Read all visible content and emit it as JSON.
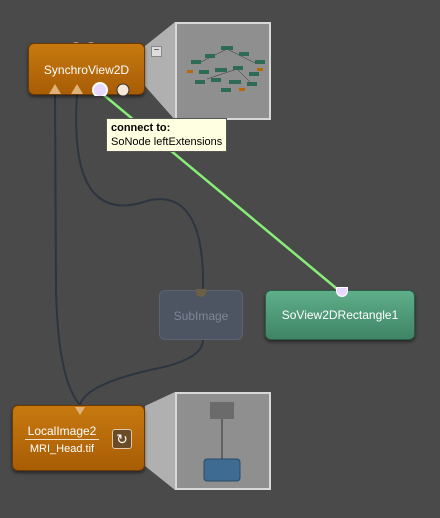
{
  "nodes": {
    "synchro": {
      "name": "SynchroView2D"
    },
    "rect": {
      "name": "SoView2DRectangle1"
    },
    "subimage": {
      "name": "SubImage"
    },
    "local": {
      "name": "LocalImage2",
      "file": "MRI_Head.tif"
    }
  },
  "tooltip": {
    "title": "connect to:",
    "detail": "SoNode leftExtensions"
  },
  "colors": {
    "node_orange": "#b8680a",
    "node_green": "#4f9a78",
    "active_link": "#88ee77",
    "background": "#4a4a4a"
  },
  "icons": {
    "refresh": "↻",
    "collapse": "−"
  }
}
